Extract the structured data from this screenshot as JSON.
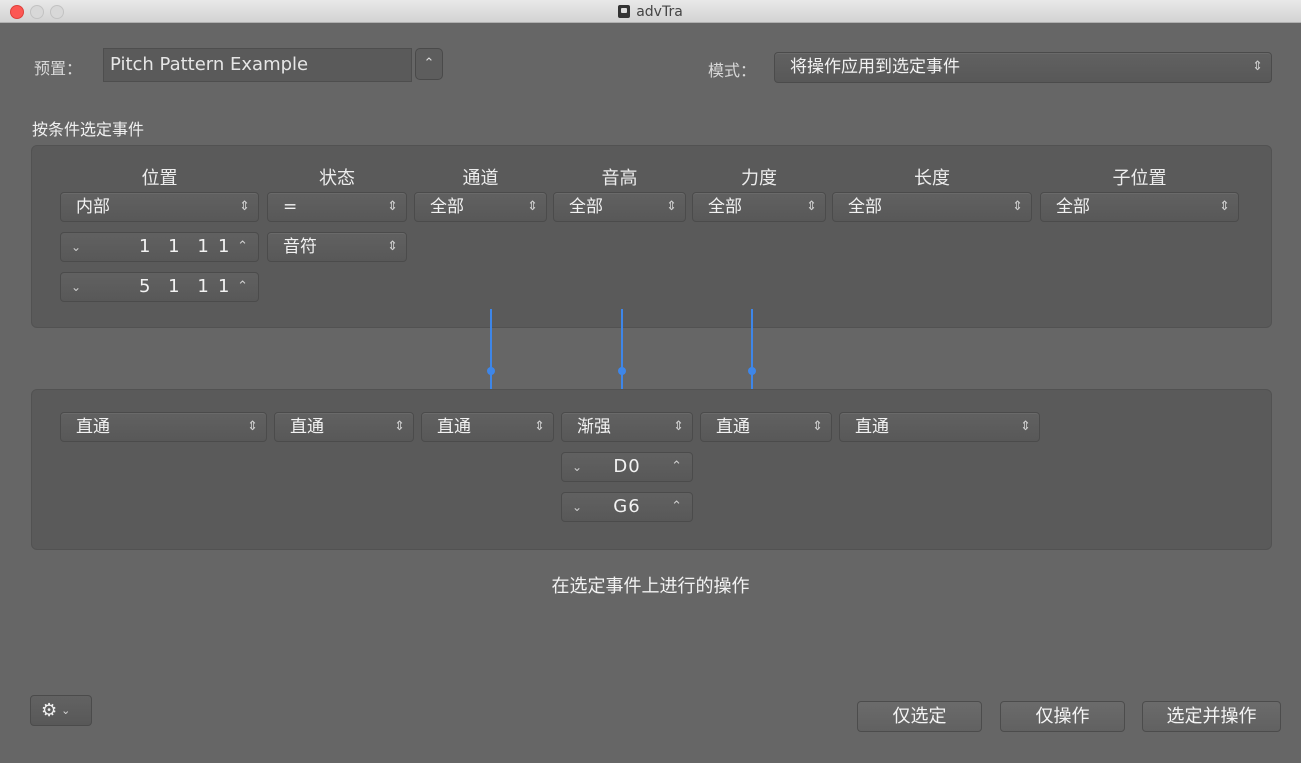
{
  "window": {
    "title": "advTra"
  },
  "preset": {
    "label": "预置：",
    "value": "Pitch Pattern Example"
  },
  "mode": {
    "label": "模式：",
    "value": "将操作应用到选定事件"
  },
  "select_section": {
    "title": "按条件选定事件",
    "columns": [
      "位置",
      "状态",
      "通道",
      "音高",
      "力度",
      "长度",
      "子位置"
    ],
    "conditions": [
      "内部",
      "=",
      "全部",
      "全部",
      "全部",
      "全部",
      "全部"
    ],
    "position_start": {
      "bars": "1 1 1",
      "ticks": "1"
    },
    "position_end": {
      "bars": "5 1 1",
      "ticks": "1"
    },
    "status_value": "音符"
  },
  "operations": {
    "values": [
      "直通",
      "直通",
      "直通",
      "渐强",
      "直通",
      "直通"
    ],
    "pitch_start": "D0",
    "pitch_end": "G6",
    "caption": "在选定事件上进行的操作"
  },
  "buttons": {
    "select_only": "仅选定",
    "operate_only": "仅操作",
    "select_and_operate": "选定并操作"
  },
  "icons": {
    "gear": "gear-icon",
    "updown": "chevron-updown-icon",
    "down": "chevron-down-icon",
    "up": "chevron-up-icon"
  },
  "colors": {
    "accent": "#3e86e8",
    "close": "#fc5753"
  }
}
